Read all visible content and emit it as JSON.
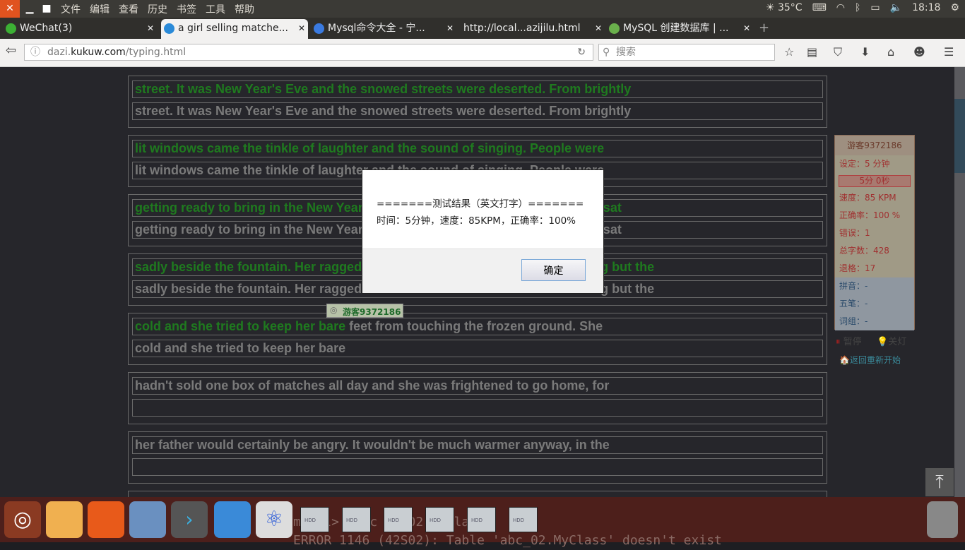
{
  "topbar": {
    "menu": [
      "文件",
      "编辑",
      "查看",
      "历史",
      "书签",
      "工具",
      "帮助"
    ],
    "weather": "35°C",
    "time": "18:18"
  },
  "tabs": [
    {
      "label": "WeChat(3)",
      "color": "#3cb034"
    },
    {
      "label": "a girl selling matche...",
      "color": "#2a8ad8",
      "active": true
    },
    {
      "label": "Mysql命令大全 - 宁...",
      "color": "#3a7ae0"
    },
    {
      "label": "http://local...azijilu.html",
      "color": ""
    },
    {
      "label": "MySQL 创建数据库 | ...",
      "color": "#6ab04c"
    }
  ],
  "nav": {
    "url_host_pre": "dazi.",
    "url_host": "kukuw.com",
    "url_path": "/typing.html",
    "search_placeholder": "搜索"
  },
  "lines": [
    {
      "source_ok": "street. It was New Year's Eve and the snowed streets were deserted. From brightly",
      "source_rest": "",
      "typed": "street. It was New Year's Eve and the snowed streets were deserted. From brightly"
    },
    {
      "source_ok": "lit windows came the tinkle of laughter and the sound of singing. People were",
      "source_rest": "",
      "typed": "lit windows came the tinkle of laughter and the sound of singing. People were"
    },
    {
      "source_ok": "getting ready to bring in the New Year with parties and merrymaking. The girl sat",
      "source_rest": "",
      "typed": "getting ready to bring in the New Year with parties and merrymaking. The girl sat"
    },
    {
      "source_ok": "sadly beside the fountain. Her ragged clothes were thin and she was shivering but the",
      "source_rest": "",
      "typed": "sadly beside the fountain. Her ragged clothes were thin and she was shivering but the"
    },
    {
      "source_ok": "cold and she tried to keep her bare",
      "source_rest": " feet from touching the frozen ground. She",
      "typed": "cold and she tried to keep her bare"
    },
    {
      "source_ok": "",
      "source_rest": "hadn't sold one box of matches all day and she was frightened to go home, for",
      "typed": ""
    },
    {
      "source_ok": "",
      "source_rest": "her father would certainly be angry. It wouldn't be much warmer anyway, in the",
      "typed": ""
    }
  ],
  "user_badge": "游客9372186",
  "stats": {
    "user": "游客9372186",
    "setting": "设定：5 分钟",
    "timer": "5分 0秒",
    "speed": "速度：85 KPM",
    "accuracy": "正确率：100 %",
    "errors": "错误：1",
    "total": "总字数：428",
    "backspace": "退格：17",
    "pinyin": "拼音：-",
    "wubi": "五笔：-",
    "phrase": "词组：-",
    "pause": "暂停",
    "lights": "关灯",
    "restart": "返回重新开始"
  },
  "dialog": {
    "title": "=======测试结果（英文打字）=======",
    "body": "时间：5分钟，速度：85KPM，正确率：100%",
    "ok": "确定"
  },
  "terminal": [
    "mysql> desc abc02.MyClass;",
    "ERROR 1146 (42S02): Table 'abc_02.MyClass' doesn't exist"
  ],
  "dock": {
    "hdd_label": "HDD"
  }
}
